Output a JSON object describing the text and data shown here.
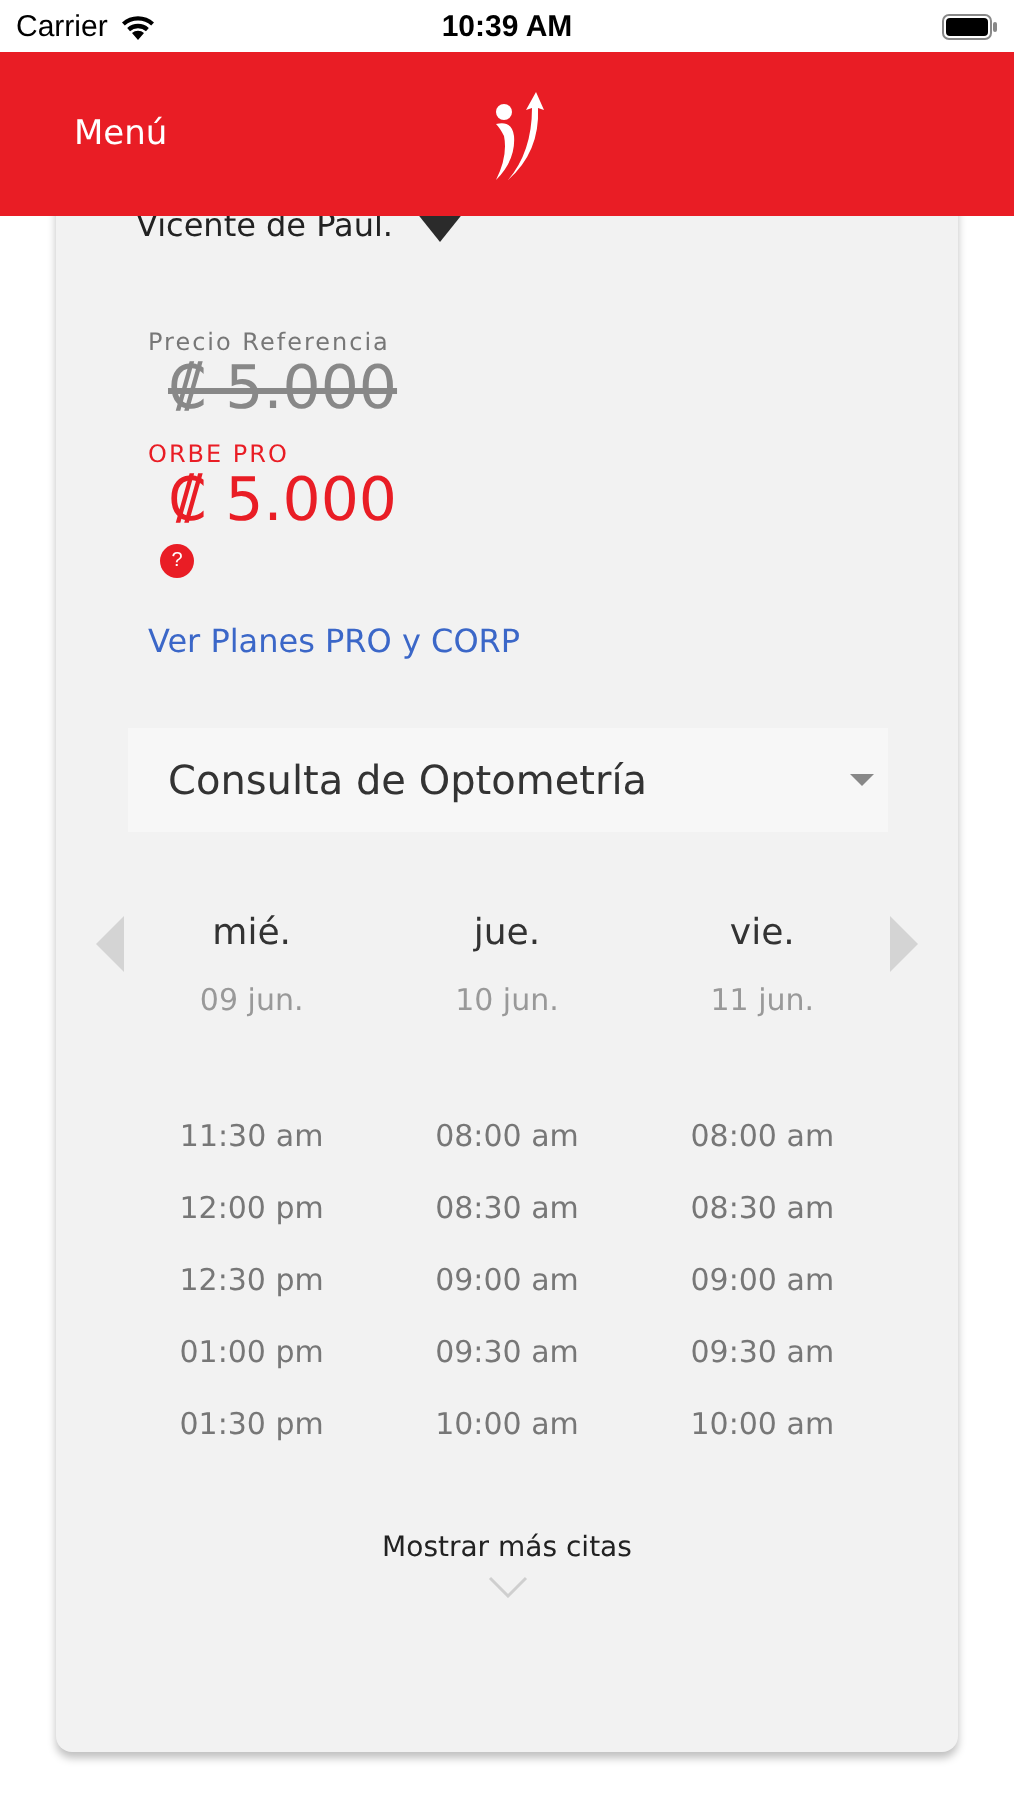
{
  "status_bar": {
    "carrier": "Carrier",
    "time": "10:39 AM"
  },
  "header": {
    "menu": "Menú"
  },
  "clinic": {
    "location": "Vicente de Paul."
  },
  "pricing": {
    "reference_label": "Precio Referencia",
    "reference_price": "₡ 5.000",
    "plan_label": "ORBE PRO",
    "plan_price": "₡ 5.000",
    "help": "?"
  },
  "plans_link": "Ver Planes PRO y CORP",
  "service_select": {
    "value": "Consulta de Optometría"
  },
  "days": [
    {
      "name": "mié.",
      "date": "09 jun.",
      "slots": [
        "11:30 am",
        "12:00 pm",
        "12:30 pm",
        "01:00 pm",
        "01:30 pm"
      ]
    },
    {
      "name": "jue.",
      "date": "10 jun.",
      "slots": [
        "08:00 am",
        "08:30 am",
        "09:00 am",
        "09:30 am",
        "10:00 am"
      ]
    },
    {
      "name": "vie.",
      "date": "11 jun.",
      "slots": [
        "08:00 am",
        "08:30 am",
        "09:00 am",
        "09:30 am",
        "10:00 am"
      ]
    }
  ],
  "more_button": "Mostrar más citas"
}
